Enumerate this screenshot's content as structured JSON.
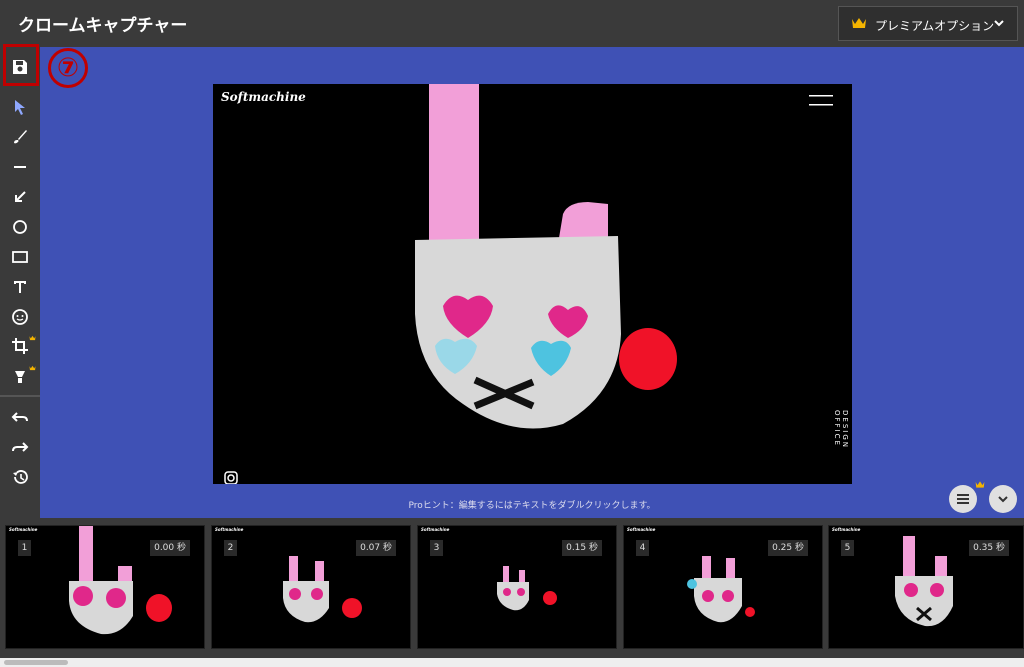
{
  "app": {
    "title": "クロームキャプチャー"
  },
  "premium": {
    "label": "プレミアムオプション",
    "crown_color": "#f4b400"
  },
  "annotation": {
    "badge": "⑦",
    "color": "#c00000"
  },
  "toolbar": {
    "tools": [
      {
        "name": "save",
        "icon": "save-icon"
      },
      {
        "name": "select",
        "icon": "cursor-arrow-icon"
      },
      {
        "name": "brush",
        "icon": "brush-icon"
      },
      {
        "name": "line",
        "icon": "line-icon"
      },
      {
        "name": "arrow",
        "icon": "arrow-icon"
      },
      {
        "name": "circle",
        "icon": "circle-icon"
      },
      {
        "name": "rectangle",
        "icon": "rectangle-icon"
      },
      {
        "name": "text",
        "icon": "text-icon"
      },
      {
        "name": "blur",
        "icon": "face-icon"
      },
      {
        "name": "crop",
        "icon": "crop-icon",
        "premium": true
      },
      {
        "name": "highlight",
        "icon": "spotlight-icon",
        "premium": true
      },
      {
        "name": "undo",
        "icon": "undo-icon"
      },
      {
        "name": "redo",
        "icon": "redo-icon"
      },
      {
        "name": "history",
        "icon": "history-icon"
      }
    ]
  },
  "preview": {
    "logo": "Softmachine",
    "side_text": "DESIGN OFFICE",
    "canvas_color": "#3f51b5"
  },
  "hint": "Proヒント：編集するにはテキストをダブルクリックします。",
  "frames": [
    {
      "number": "1",
      "time": "0.00 秒"
    },
    {
      "number": "2",
      "time": "0.07 秒"
    },
    {
      "number": "3",
      "time": "0.15 秒"
    },
    {
      "number": "4",
      "time": "0.25 秒"
    },
    {
      "number": "5",
      "time": "0.35 秒"
    }
  ],
  "frame_logo": "Softmachine"
}
